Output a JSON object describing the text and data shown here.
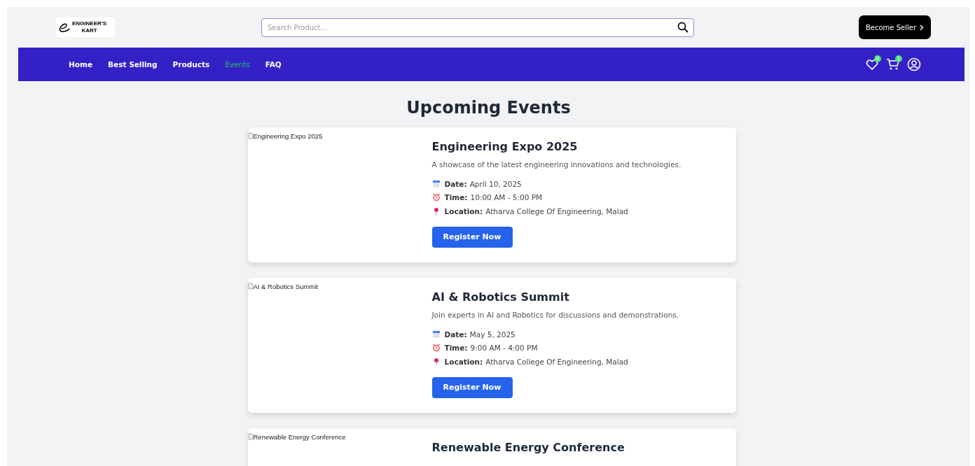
{
  "header": {
    "logo": {
      "line1": "ENGINEER'S",
      "line2": "KART"
    },
    "search": {
      "placeholder": "Search Product..."
    },
    "seller_button": "Become Seller"
  },
  "nav": {
    "items": [
      {
        "label": "Home",
        "selected": false
      },
      {
        "label": "Best Selling",
        "selected": false
      },
      {
        "label": "Products",
        "selected": false
      },
      {
        "label": "Events",
        "selected": true
      },
      {
        "label": "FAQ",
        "selected": false
      }
    ],
    "wishlist_count": "0",
    "cart_count": "1"
  },
  "heading": "Upcoming Events",
  "events": [
    {
      "image_alt": "Engineering Expo 2025",
      "title": "Engineering Expo 2025",
      "description": "A showcase of the latest engineering innovations and technologies.",
      "details": [
        {
          "kind": "date",
          "label": "Date:",
          "value": "April 10, 2025"
        },
        {
          "kind": "time",
          "label": "Time:",
          "value": "10:00 AM - 5:00 PM"
        },
        {
          "kind": "location",
          "label": "Location:",
          "value": "Atharva College Of Engineering, Malad"
        }
      ],
      "button": "Register Now"
    },
    {
      "image_alt": "AI & Robotics Summit",
      "title": "AI & Robotics Summit",
      "description": "Join experts in AI and Robotics for discussions and demonstrations.",
      "details": [
        {
          "kind": "date",
          "label": "Date:",
          "value": "May 5, 2025"
        },
        {
          "kind": "time",
          "label": "Time:",
          "value": "9:00 AM - 4:00 PM"
        },
        {
          "kind": "location",
          "label": "Location:",
          "value": "Atharva College Of Engineering, Malad"
        }
      ],
      "button": "Register Now"
    },
    {
      "image_alt": "Renewable Energy Conference",
      "title": "Renewable Energy Conference"
    }
  ]
}
